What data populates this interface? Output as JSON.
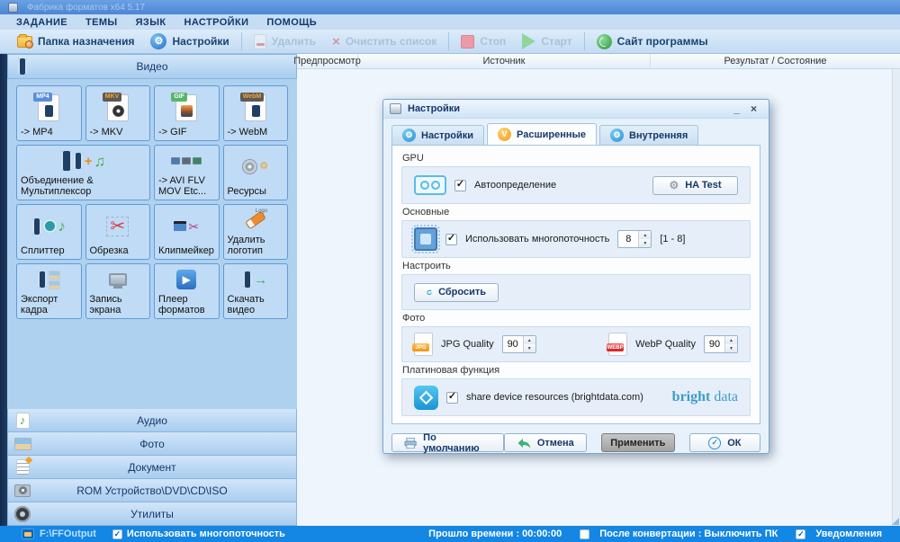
{
  "window": {
    "title": "Фабрика форматов x64 5.17"
  },
  "menu": {
    "items": [
      "ЗАДАНИЕ",
      "ТЕМЫ",
      "ЯЗЫК",
      "НАСТРОЙКИ",
      "ПОМОЩЬ"
    ]
  },
  "toolbar": {
    "dest_folder": "Папка назначения",
    "settings": "Настройки",
    "remove": "Удалить",
    "clear_list": "Очистить список",
    "stop": "Стоп",
    "start": "Старт",
    "website": "Сайт программы"
  },
  "sidebar": {
    "video_header": "Видео",
    "video_tiles": [
      {
        "label": "-> MP4",
        "badge": "MP4"
      },
      {
        "label": "-> MKV",
        "badge": "MKV"
      },
      {
        "label": "-> GIF",
        "badge": "GIF"
      },
      {
        "label": "-> WebM",
        "badge": "WebM"
      },
      {
        "label": "Объединение & Мультиплексор"
      },
      {
        "label": "-> AVI FLV MOV Etc..."
      },
      {
        "label": "Ресурсы"
      },
      {
        "label": "Сплиттер"
      },
      {
        "label": "Обрезка"
      },
      {
        "label": "Клипмейкер"
      },
      {
        "label": "Удалить логотип",
        "logo_tag": "Logo"
      },
      {
        "label": "Экспорт кадра"
      },
      {
        "label": "Запись экрана"
      },
      {
        "label": "Плеер форматов"
      },
      {
        "label": "Скачать видео"
      }
    ],
    "sections": [
      "Аудио",
      "Фото",
      "Документ",
      "ROM Устройство\\DVD\\CD\\ISO",
      "Утилиты"
    ]
  },
  "table": {
    "columns": [
      "Предпросмотр",
      "Источник",
      "Результат / Состояние"
    ]
  },
  "dialog": {
    "title": "Настройки",
    "minimize": "_",
    "close": "×",
    "tabs": [
      {
        "label": "Настройки"
      },
      {
        "label": "Расширенные",
        "badge": "V"
      },
      {
        "label": "Внутренняя"
      }
    ],
    "gpu": {
      "label": "GPU",
      "checkbox": "Автоопределение",
      "button": "HA Test"
    },
    "general": {
      "label": "Основные",
      "checkbox": "Использовать многопоточность",
      "value": "8",
      "range": "[1 - 8]"
    },
    "customize": {
      "label": "Настроить",
      "button": "Сбросить"
    },
    "photo": {
      "label": "Фото",
      "jpg_label": "JPG Quality",
      "jpg_value": "90",
      "jpg_badge": "JPG",
      "webp_label": "WebP Quality",
      "webp_value": "90",
      "webp_badge": "WEBP"
    },
    "platinum": {
      "label": "Платиновая функция",
      "checkbox": "share device resources (brightdata.com)",
      "logo_brand_1": "bright",
      "logo_brand_2": "data"
    },
    "buttons": {
      "default": "По умолчанию",
      "cancel": "Отмена",
      "apply": "Применить",
      "ok": "ОК"
    }
  },
  "statusbar": {
    "output_path": "F:\\FFOutput",
    "multithread": "Использовать многопоточность",
    "elapsed": "Прошло времени : 00:00:00",
    "after_convert": "После конвертации : Выключить ПК",
    "notifications": "Уведомления"
  },
  "icons": {
    "gear": "⚙",
    "scissors": "✂",
    "music_note": "♪",
    "music_notes": "♫",
    "play": "▶",
    "check": "✓",
    "arrow_up": "▲",
    "arrow_down": "▼",
    "plus": "+",
    "arrow_right": "→",
    "refresh": "↻"
  }
}
